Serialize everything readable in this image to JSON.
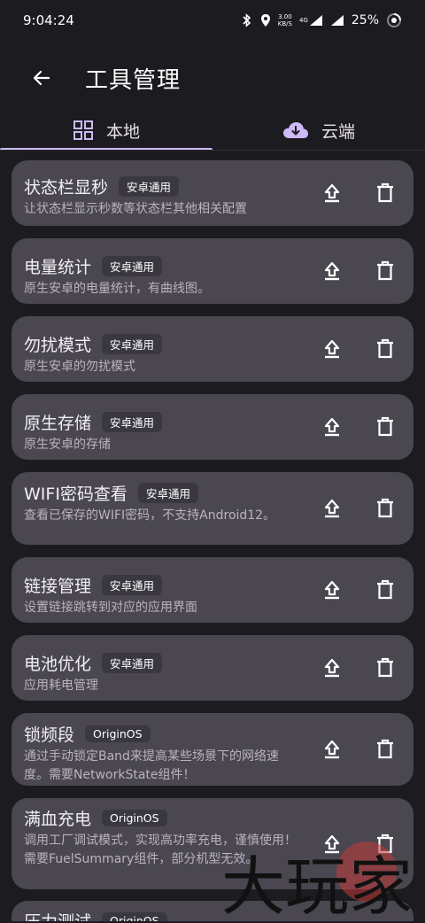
{
  "status": {
    "time": "9:04:24",
    "net_speed_value": "3.00",
    "net_speed_unit": "KB/S",
    "network_type": "4G",
    "battery": "25%"
  },
  "header": {
    "title": "工具管理",
    "back_icon": "arrow-left-icon"
  },
  "tabs": [
    {
      "label": "本地",
      "icon": "grid-icon",
      "active": true
    },
    {
      "label": "云端",
      "icon": "cloud-download-icon",
      "active": false
    }
  ],
  "tools": [
    {
      "name": "状态栏显秒",
      "badge": "安卓通用",
      "desc": "让状态栏显示秒数等状态栏其他相关配置"
    },
    {
      "name": "电量统计",
      "badge": "安卓通用",
      "desc": "原生安卓的电量统计，有曲线图。"
    },
    {
      "name": "勿扰模式",
      "badge": "安卓通用",
      "desc": "原生安卓的勿扰模式"
    },
    {
      "name": "原生存储",
      "badge": "安卓通用",
      "desc": "原生安卓的存储"
    },
    {
      "name": "WIFI密码查看",
      "badge": "安卓通用",
      "desc": "查看已保存的WIFI密码，不支持Android12。"
    },
    {
      "name": "链接管理",
      "badge": "安卓通用",
      "desc": "设置链接跳转到对应的应用界面"
    },
    {
      "name": "电池优化",
      "badge": "安卓通用",
      "desc": "应用耗电管理"
    },
    {
      "name": "锁频段",
      "badge": "OriginOS",
      "desc": "通过手动锁定Band来提高某些场景下的网络速度。需要NetworkState组件！"
    },
    {
      "name": "满血充电",
      "badge": "OriginOS",
      "desc": "调用工厂调试模式，实现高功率充电，谨慎使用！需要FuelSummary组件，部分机型无效。"
    },
    {
      "name": "压力测试",
      "badge": "OriginOS",
      "desc": ""
    }
  ],
  "watermark": {
    "text": "大玩家"
  },
  "colors": {
    "background": "#1c1b1f",
    "card": "#4a4751",
    "badge": "#3a3741",
    "accent": "#cbbaf5",
    "watermark": "#c43a3a"
  }
}
